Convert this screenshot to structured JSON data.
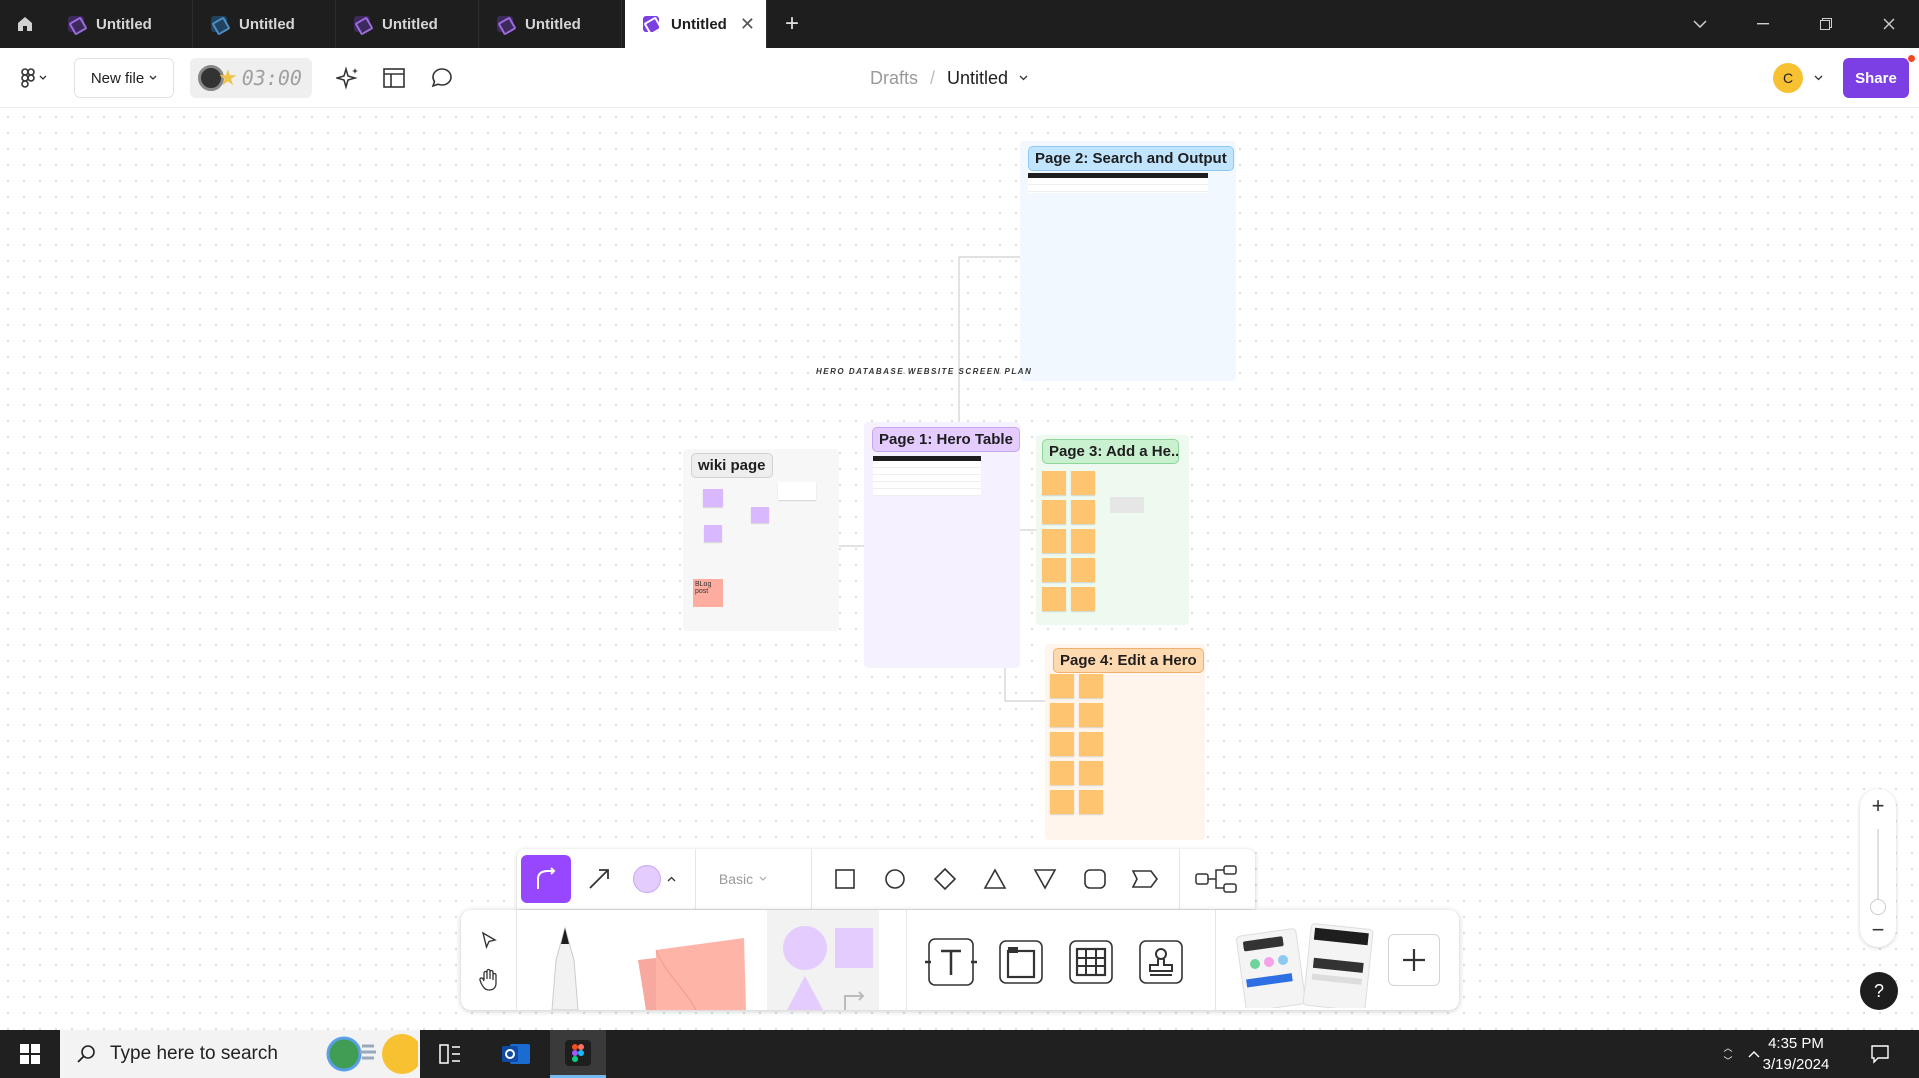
{
  "tabs": [
    {
      "label": "Untitled",
      "active": false
    },
    {
      "label": "Untitled",
      "active": false
    },
    {
      "label": "Untitled",
      "active": false
    },
    {
      "label": "Untitled",
      "active": false
    },
    {
      "label": "Untitled",
      "active": true
    }
  ],
  "toolbar": {
    "new_file_label": "New file",
    "timer_text": "03:00",
    "breadcrumb_parent": "Drafts",
    "breadcrumb_separator": "/",
    "file_title": "Untitled",
    "avatar_initial": "C",
    "share_label": "Share",
    "accent_color": "#7b3fe4"
  },
  "canvas": {
    "plan_title": "HERO DATABASE WEBSITE SCREEN PLAN",
    "sections": {
      "page2": {
        "label": "Page 2: Search and Output"
      },
      "page1": {
        "label": "Page 1: Hero Table"
      },
      "page3": {
        "label": "Page 3: Add a He..."
      },
      "page4": {
        "label": "Page 4: Edit a Hero"
      },
      "wiki": {
        "label": "wiki page",
        "blog_note": "BLog post"
      }
    }
  },
  "shape_bar": {
    "style_label": "Basic"
  },
  "taskbar": {
    "search_placeholder": "Type here to search",
    "time": "4:35 PM",
    "date": "3/19/2024"
  }
}
